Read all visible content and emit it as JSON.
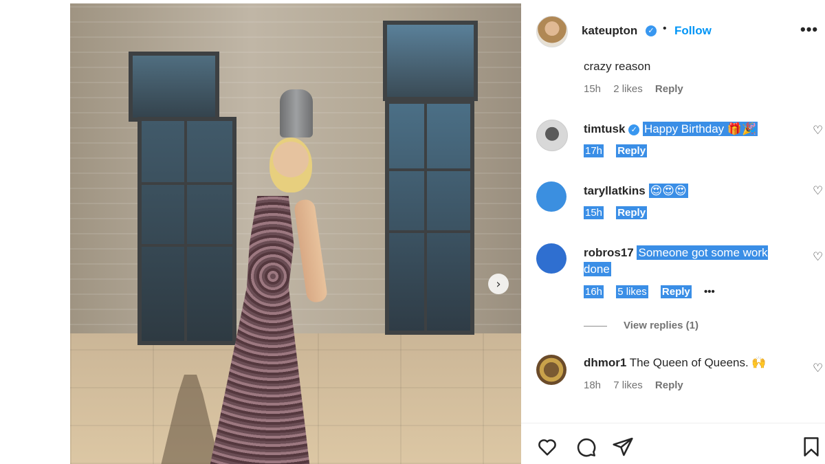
{
  "post": {
    "next_icon": "chevron-right-icon"
  },
  "header": {
    "username": "kateupton",
    "separator": "•",
    "follow_label": "Follow",
    "more_label": "•••",
    "verified_symbol": "✓"
  },
  "comments": [
    {
      "text": "crazy reason",
      "time": "15h",
      "likes": "2 likes",
      "reply": "Reply"
    },
    {
      "username": "timtusk",
      "text": "Happy Birthday 🎁🎉",
      "time": "17h",
      "reply": "Reply",
      "highlighted": true
    },
    {
      "username": "taryllatkins",
      "text": "😍😍😍",
      "time": "15h",
      "reply": "Reply",
      "highlighted": true
    },
    {
      "username": "robros17",
      "text": "Someone got some work done",
      "time": "16h",
      "likes": "5 likes",
      "reply": "Reply",
      "more": "•••",
      "view_replies": "View replies (1)",
      "highlighted": true
    },
    {
      "username": "dhmor1",
      "text": "The Queen of Queens. 🙌",
      "time": "18h",
      "likes": "7 likes",
      "reply": "Reply"
    }
  ],
  "icons": {
    "like": "heart-icon",
    "comment": "comment-icon",
    "share": "share-icon",
    "save": "bookmark-icon",
    "comment_like": "heart-icon"
  },
  "colors": {
    "follow": "#0095f6",
    "highlight": "#3a8ee6",
    "verified": "#3897f0",
    "muted_text": "#737373"
  }
}
